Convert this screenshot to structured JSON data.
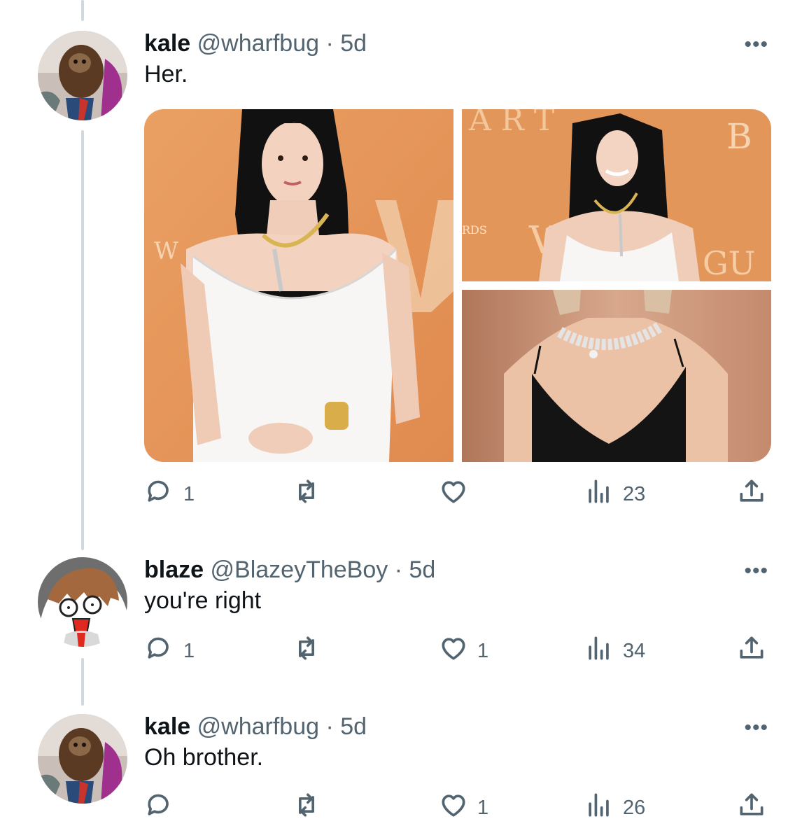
{
  "tweets": [
    {
      "name": "kale",
      "handle": "@wharfbug",
      "separator": "·",
      "time": "5d",
      "text": "Her.",
      "more_label": "•••",
      "replies": "1",
      "retweets": "",
      "likes": "",
      "views": "23",
      "images": [
        "woman-white-dress-orange-backdrop",
        "woman-smiling-white-dress",
        "black-dress-diamond-necklace"
      ]
    },
    {
      "name": "blaze",
      "handle": "@BlazeyTheBoy",
      "separator": "·",
      "time": "5d",
      "text": "you're right",
      "more_label": "•••",
      "replies": "1",
      "retweets": "",
      "likes": "1",
      "views": "34"
    },
    {
      "name": "kale",
      "handle": "@wharfbug",
      "separator": "·",
      "time": "5d",
      "text": "Oh brother.",
      "more_label": "•••",
      "replies": "",
      "retweets": "",
      "likes": "1",
      "views": "26"
    }
  ],
  "colors": {
    "text": "#0f1419",
    "secondary": "#536471",
    "thread_line": "#cfd9de",
    "backdrop_orange": "#e79a5f"
  },
  "icons": [
    "reply-icon",
    "retweet-icon",
    "like-icon",
    "views-icon",
    "share-icon",
    "more-icon"
  ]
}
